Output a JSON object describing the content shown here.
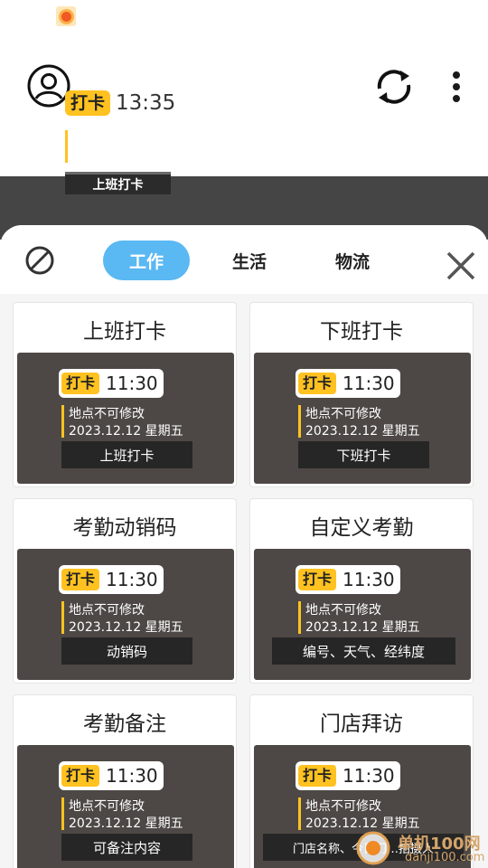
{
  "stamp": {
    "badge": "打卡",
    "time": "13:35",
    "label": "上班打卡"
  },
  "tabs": [
    {
      "label": "工作"
    },
    {
      "label": "生活"
    },
    {
      "label": "物流"
    }
  ],
  "cards": [
    {
      "title": "上班打卡",
      "badge": "打卡",
      "time": "11:30",
      "line1": "地点不可修改",
      "line2": "2023.12.12  星期五",
      "label": "上班打卡"
    },
    {
      "title": "下班打卡",
      "badge": "打卡",
      "time": "11:30",
      "line1": "地点不可修改",
      "line2": "2023.12.12  星期五",
      "label": "下班打卡"
    },
    {
      "title": "考勤动销码",
      "badge": "打卡",
      "time": "11:30",
      "line1": "地点不可修改",
      "line2": "2023.12.12  星期五",
      "label": "动销码"
    },
    {
      "title": "自定义考勤",
      "badge": "打卡",
      "time": "11:30",
      "line1": "地点不可修改",
      "line2": "2023.12.12  星期五",
      "label": "编号、天气、经纬度"
    },
    {
      "title": "考勤备注",
      "badge": "打卡",
      "time": "11:30",
      "line1": "地点不可修改",
      "line2": "2023.12.12  星期五",
      "label": "可备注内容"
    },
    {
      "title": "门店拜访",
      "badge": "打卡",
      "time": "11:30",
      "line1": "地点不可修改",
      "line2": "2023.12.12  星期五",
      "label": "门店名称、今日门…拍摄人"
    }
  ],
  "watermark": {
    "line1": "单机100网",
    "line2": "danji100.com"
  },
  "colors": {
    "accent_tab": "#5ab8f2",
    "stamp_yellow": "#ffc220",
    "preview_bg": "#4d4845"
  }
}
